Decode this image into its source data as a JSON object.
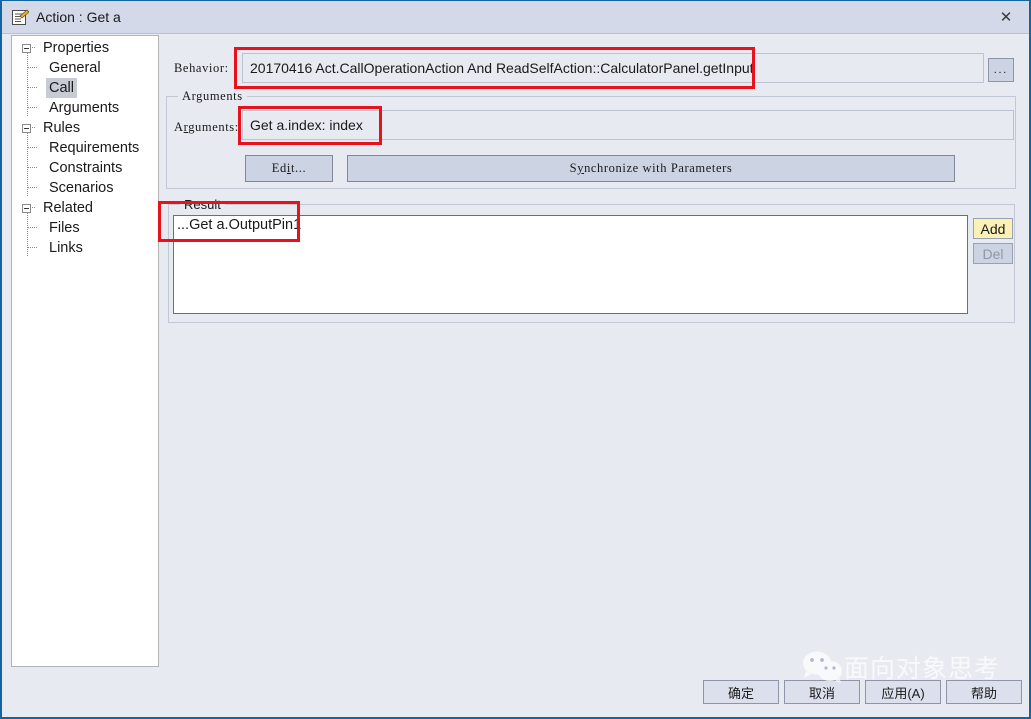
{
  "window": {
    "title": "Action : Get a",
    "icon": "action-dialog-icon",
    "close_label": "✕"
  },
  "sidebar": {
    "nodes": [
      {
        "label": "Properties",
        "level": 0,
        "expanded": true,
        "selected": false
      },
      {
        "label": "General",
        "level": 1,
        "expanded": false,
        "selected": false
      },
      {
        "label": "Call",
        "level": 1,
        "expanded": false,
        "selected": true
      },
      {
        "label": "Arguments",
        "level": 1,
        "expanded": false,
        "selected": false
      },
      {
        "label": "Rules",
        "level": 0,
        "expanded": true,
        "selected": false
      },
      {
        "label": "Requirements",
        "level": 1,
        "expanded": false,
        "selected": false
      },
      {
        "label": "Constraints",
        "level": 1,
        "expanded": false,
        "selected": false
      },
      {
        "label": "Scenarios",
        "level": 1,
        "expanded": false,
        "selected": false
      },
      {
        "label": "Related",
        "level": 0,
        "expanded": true,
        "selected": false
      },
      {
        "label": "Files",
        "level": 1,
        "expanded": false,
        "selected": false
      },
      {
        "label": "Links",
        "level": 1,
        "expanded": false,
        "selected": false
      }
    ]
  },
  "behavior": {
    "label": "Behavior:",
    "value": "20170416 Act.CallOperationAction And ReadSelfAction::CalculatorPanel.getInput",
    "browse_label": "..."
  },
  "arguments_group": {
    "title": "Arguments",
    "field_label_pre": "A",
    "field_label_mnemonic": "r",
    "field_label_post": "guments:",
    "value": "Get a.index: index",
    "edit_pre": "Ed",
    "edit_mnemonic": "i",
    "edit_post": "t...",
    "sync_pre": "S",
    "sync_mnemonic": "y",
    "sync_post": "nchronize with Parameters"
  },
  "result_group": {
    "title": "Result",
    "items": [
      "...Get a.OutputPin1"
    ],
    "add_label": "Add",
    "del_label": "Del"
  },
  "footer": {
    "ok_label": "确定",
    "cancel_label": "取消",
    "apply_label": "应用(A)",
    "help_label": "帮助"
  },
  "watermark": {
    "text": "面向对象思考",
    "icon": "wechat-icon"
  },
  "colors": {
    "window_border": "#1464a0",
    "titlebar": "#d3d9e8",
    "dialog_bg": "#e8eaf2",
    "annotation_red": "#e8121d",
    "add_button_bg": "#fbf0b6",
    "selection_bg": "#c6cbd4"
  }
}
